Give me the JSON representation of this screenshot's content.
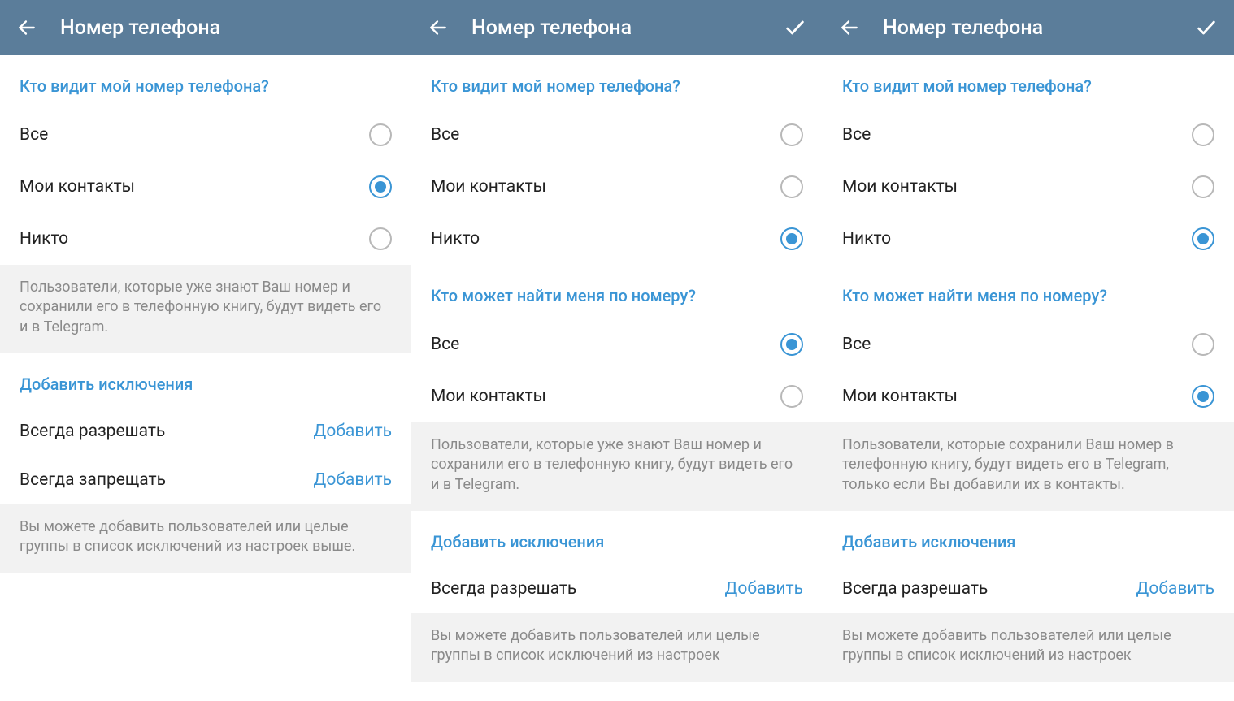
{
  "panels": [
    {
      "title": "Номер телефона",
      "hasCheck": false,
      "sections": [
        {
          "header": "Кто видит мой номер телефона?",
          "type": "radio",
          "options": [
            {
              "label": "Все",
              "selected": false
            },
            {
              "label": "Мои контакты",
              "selected": true
            },
            {
              "label": "Никто",
              "selected": false
            }
          ]
        },
        {
          "type": "info",
          "text": "Пользователи, которые уже знают Ваш номер и сохранили его в телефонную книгу, будут видеть его и в Telegram."
        },
        {
          "header": "Добавить исключения",
          "type": "actions",
          "actions": [
            {
              "label": "Всегда разрешать",
              "link": "Добавить"
            },
            {
              "label": "Всегда запрещать",
              "link": "Добавить"
            }
          ]
        },
        {
          "type": "info",
          "text": "Вы можете добавить пользователей или целые группы в список исключений из настроек выше."
        }
      ]
    },
    {
      "title": "Номер телефона",
      "hasCheck": true,
      "sections": [
        {
          "header": "Кто видит мой номер телефона?",
          "type": "radio",
          "options": [
            {
              "label": "Все",
              "selected": false
            },
            {
              "label": "Мои контакты",
              "selected": false
            },
            {
              "label": "Никто",
              "selected": true
            }
          ]
        },
        {
          "header": "Кто может найти меня по номеру?",
          "type": "radio",
          "options": [
            {
              "label": "Все",
              "selected": true
            },
            {
              "label": "Мои контакты",
              "selected": false
            }
          ]
        },
        {
          "type": "info",
          "text": "Пользователи, которые уже знают Ваш номер и сохранили его в телефонную книгу, будут видеть его и в Telegram."
        },
        {
          "header": "Добавить исключения",
          "type": "actions",
          "actions": [
            {
              "label": "Всегда разрешать",
              "link": "Добавить"
            }
          ]
        },
        {
          "type": "info",
          "text": "Вы можете добавить пользователей или целые группы в список исключений из настроек"
        }
      ]
    },
    {
      "title": "Номер телефона",
      "hasCheck": true,
      "sections": [
        {
          "header": "Кто видит мой номер телефона?",
          "type": "radio",
          "options": [
            {
              "label": "Все",
              "selected": false
            },
            {
              "label": "Мои контакты",
              "selected": false
            },
            {
              "label": "Никто",
              "selected": true
            }
          ]
        },
        {
          "header": "Кто может найти меня по номеру?",
          "type": "radio",
          "options": [
            {
              "label": "Все",
              "selected": false
            },
            {
              "label": "Мои контакты",
              "selected": true
            }
          ]
        },
        {
          "type": "info",
          "text": "Пользователи, которые сохранили Ваш номер в телефонную книгу, будут видеть его в Telegram, только если Вы добавили их в контакты."
        },
        {
          "header": "Добавить исключения",
          "type": "actions",
          "actions": [
            {
              "label": "Всегда разрешать",
              "link": "Добавить"
            }
          ]
        },
        {
          "type": "info",
          "text": "Вы можете добавить пользователей или целые группы в список исключений из настроек"
        }
      ]
    }
  ]
}
